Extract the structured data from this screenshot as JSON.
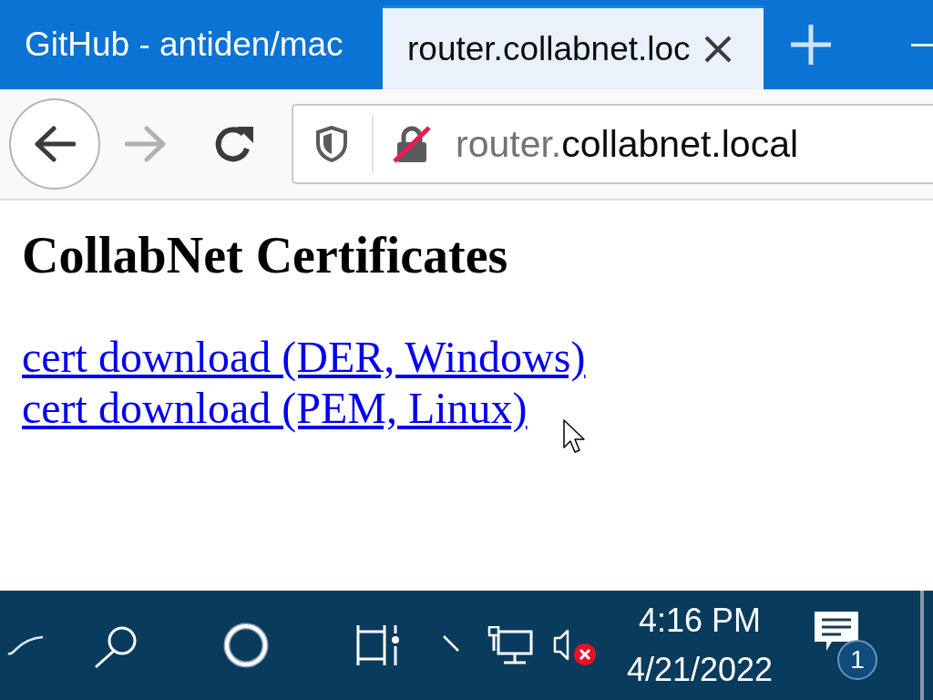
{
  "browser": {
    "tabs": [
      {
        "title": "GitHub - antiden/mac",
        "selected": false
      },
      {
        "title": "router.collabnet.loc",
        "selected": true
      }
    ],
    "toolbar": {
      "forward_disabled": true,
      "connection_secure": false,
      "url": {
        "subdomain": "router.",
        "domain": "collabnet.local"
      }
    }
  },
  "page": {
    "heading": "CollabNet Certificates",
    "links": [
      "cert download (DER, Windows)",
      "cert download (PEM, Linux)"
    ]
  },
  "taskbar": {
    "volume_muted": true,
    "clock": {
      "time": "4:16 PM",
      "date": "4/21/2022"
    },
    "notification_count": "1"
  }
}
